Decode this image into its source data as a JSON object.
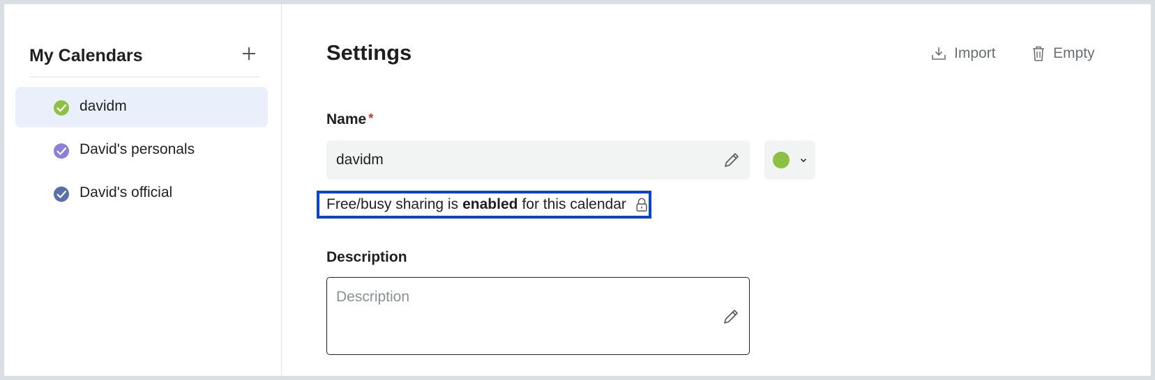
{
  "sidebar": {
    "title": "My Calendars",
    "add_icon": "plus-icon",
    "calendars": [
      {
        "label": "davidm",
        "color": "#8dc043",
        "selected": true
      },
      {
        "label": "David's personals",
        "color": "#8b7fd8",
        "selected": false
      },
      {
        "label": "David's official",
        "color": "#5a6fa8",
        "selected": false
      }
    ]
  },
  "main": {
    "title": "Settings",
    "actions": {
      "import_label": "Import",
      "import_icon": "import-icon",
      "empty_label": "Empty",
      "empty_icon": "trash-icon"
    },
    "name_field": {
      "label": "Name",
      "required_marker": "*",
      "value": "davidm",
      "color": "#8dc043"
    },
    "freebusy": {
      "prefix": "Free/busy sharing is",
      "status": "enabled",
      "suffix": "for this calendar",
      "icon": "lock-icon"
    },
    "description_field": {
      "label": "Description",
      "placeholder": "Description"
    }
  },
  "colors": {
    "accent_border": "#0a44c8",
    "selected_bg": "#e9f0fb"
  }
}
